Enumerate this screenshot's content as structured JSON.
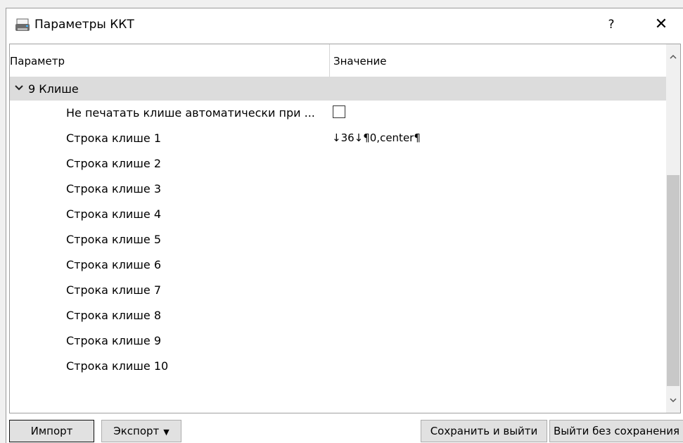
{
  "window": {
    "title": "Параметры ККТ",
    "help": "?",
    "close": "✕"
  },
  "grid": {
    "col_param": "Параметр",
    "col_value": "Значение",
    "group": {
      "expand_glyph": "❯",
      "label": "9 Клише"
    },
    "rows": [
      {
        "param": "Не печатать клише автоматически при ...",
        "value": "",
        "type": "checkbox",
        "checked": false
      },
      {
        "param": "Строка клише 1",
        "value": "↓36↓¶0,center¶"
      },
      {
        "param": "Строка клише 2",
        "value": ""
      },
      {
        "param": "Строка клише 3",
        "value": ""
      },
      {
        "param": "Строка клише 4",
        "value": ""
      },
      {
        "param": "Строка клише 5",
        "value": ""
      },
      {
        "param": "Строка клише 6",
        "value": ""
      },
      {
        "param": "Строка клише 7",
        "value": ""
      },
      {
        "param": "Строка клише 8",
        "value": ""
      },
      {
        "param": "Строка клише 9",
        "value": ""
      },
      {
        "param": "Строка клише 10",
        "value": ""
      }
    ]
  },
  "scrollbar": {
    "up": "^",
    "down": "v"
  },
  "buttons": {
    "import": "Импорт",
    "export": "Экспорт",
    "export_arrow": "▼",
    "save_exit": "Сохранить и выйти",
    "exit_no_save": "Выйти без сохранения"
  }
}
